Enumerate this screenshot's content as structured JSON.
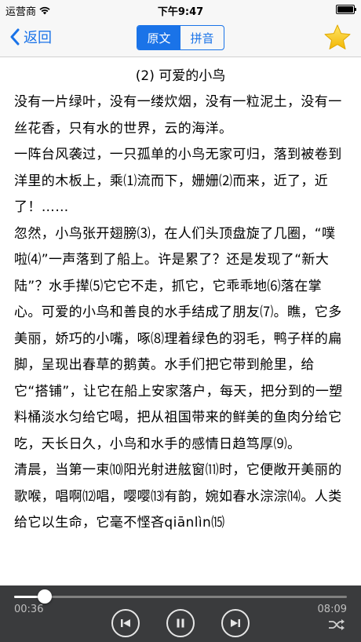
{
  "status_bar": {
    "carrier": "运营商",
    "time": "下午9:47"
  },
  "nav": {
    "back_label": "返回",
    "segments": [
      {
        "label": "原文",
        "active": true
      },
      {
        "label": "拼音",
        "active": false
      }
    ],
    "accent_color": "#1a73e8",
    "star_color": "#f5c518"
  },
  "article": {
    "title": "(2) 可爱的小鸟",
    "paragraphs": [
      "没有一片绿叶，没有一缕炊烟，没有一粒泥土，没有一丝花香，只有水的世界，云的海洋。",
      "一阵台风袭过，一只孤单的小鸟无家可归，落到被卷到洋里的木板上，乘⑴流而下，姗姗⑵而来，近了，近了！……",
      "忽然，小鸟张开翅膀⑶，在人们头顶盘旋了几圈，“噗啦⑷”一声落到了船上。许是累了？还是发现了“新大陆”？水手撵⑸它它不走，抓它，它乖乖地⑹落在掌心。可爱的小鸟和善良的水手结成了朋友⑺。瞧，它多美丽，娇巧的小嘴，啄⑻理着绿色的羽毛，鸭子样的扁脚，呈现出春草的鹅黄。水手们把它带到舱里，给它“搭铺”，让它在船上安家落户，每天，把分到的一塑料桶淡水匀给它喝，把从祖国带来的鲜美的鱼肉分给它吃，天长日久，小鸟和水手的感情日趋笃厚⑼。",
      "清晨，当第一束⑽阳光射进舷窗⑾时，它便敞开美丽的歌喉，唱啊⑿唱，嘤嘤⒀有韵，婉如春水淙淙⒁。人类给它以生命，它毫不悭吝qiānlìn⒂"
    ]
  },
  "player": {
    "elapsed": "00:36",
    "total": "08:09",
    "progress": 0.093,
    "controls": {
      "previous": "previous",
      "pause": "pause",
      "next": "next",
      "shuffle": "shuffle"
    }
  }
}
